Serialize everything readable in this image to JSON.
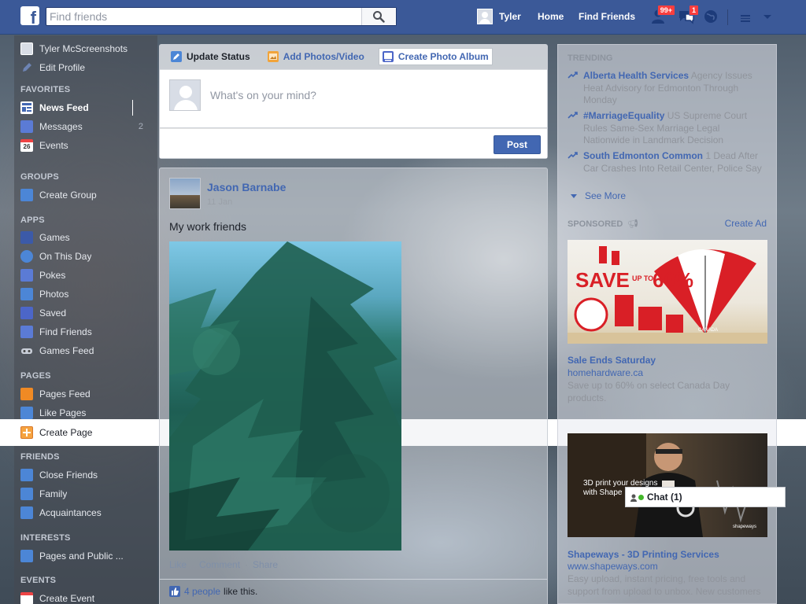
{
  "topbar": {
    "logo": "f",
    "search_placeholder": "Find friends",
    "profile_name": "Tyler",
    "links": [
      "Home",
      "Find Friends"
    ],
    "friend_requests_badge": "99+",
    "messages_badge": "1"
  },
  "sidebar": {
    "profile": {
      "name": "Tyler McScreenshots",
      "edit": "Edit Profile"
    },
    "sections": {
      "favorites": "FAVORITES",
      "groups": "GROUPS",
      "apps": "APPS",
      "pages": "PAGES",
      "friends": "FRIENDS",
      "interests": "INTERESTS",
      "events": "EVENTS"
    },
    "favorites": [
      {
        "label": "News Feed",
        "icon": "news-feed-icon"
      },
      {
        "label": "Messages",
        "icon": "messages-icon",
        "count": "2"
      },
      {
        "label": "Events",
        "icon": "calendar-icon",
        "date": "26"
      }
    ],
    "groups": [
      {
        "label": "Create Group",
        "icon": "create-group-icon"
      }
    ],
    "apps": [
      {
        "label": "Games",
        "icon": "games-icon"
      },
      {
        "label": "On This Day",
        "icon": "on-this-day-icon"
      },
      {
        "label": "Pokes",
        "icon": "pokes-icon"
      },
      {
        "label": "Photos",
        "icon": "photos-icon"
      },
      {
        "label": "Saved",
        "icon": "saved-icon"
      },
      {
        "label": "Find Friends",
        "icon": "find-friends-icon"
      },
      {
        "label": "Games Feed",
        "icon": "games-feed-icon"
      }
    ],
    "pages": [
      {
        "label": "Pages Feed",
        "icon": "pages-feed-icon"
      },
      {
        "label": "Like Pages",
        "icon": "like-pages-icon"
      },
      {
        "label": "Create Page",
        "icon": "create-page-icon"
      }
    ],
    "friends": [
      {
        "label": "Close Friends",
        "icon": "close-friends-icon"
      },
      {
        "label": "Family",
        "icon": "family-icon"
      },
      {
        "label": "Acquaintances",
        "icon": "acquaintances-icon"
      }
    ],
    "interests": [
      {
        "label": "Pages and Public ...",
        "icon": "pages-public-icon"
      }
    ],
    "events": [
      {
        "label": "Create Event",
        "icon": "create-event-icon"
      }
    ]
  },
  "composer": {
    "tabs": [
      "Update Status",
      "Add Photos/Video",
      "Create Photo Album"
    ],
    "placeholder": "What's on your mind?",
    "post_label": "Post"
  },
  "story": {
    "author": "Jason Barnabe",
    "time": "11 Jan",
    "text": "My work friends",
    "actions": [
      "Like",
      "Comment",
      "Share"
    ],
    "likes_link": "4 people",
    "likes_suffix": "like this."
  },
  "rightcol": {
    "trending_title": "TRENDING",
    "trending": [
      {
        "topic": "Alberta Health Services",
        "desc": "Agency Issues Heat Advisory for Edmonton Through Monday"
      },
      {
        "topic": "#MarriageEquality",
        "desc": "US Supreme Court Rules Same-Sex Marriage Legal Nationwide in Landmark Decision"
      },
      {
        "topic": "South Edmonton Common",
        "desc": "1 Dead After Car Crashes Into Retail Center, Police Say"
      }
    ],
    "see_more": "See More",
    "sponsored_title": "SPONSORED",
    "create_ad": "Create Ad",
    "ads": [
      {
        "image_text": {
          "save": "SAVE",
          "up_to": "UP TO",
          "pct": "60%",
          "canada": "CANADA"
        },
        "title": "Sale Ends Saturday",
        "url": "homehardware.ca",
        "desc": "Save up to 60% on select Canada Day products."
      },
      {
        "image_text": {
          "line1": "3D print your designs",
          "line2": "with Shape",
          "brand": "shapeways"
        },
        "title": "Shapeways - 3D Printing Services",
        "url": "www.shapeways.com",
        "desc": "Easy upload, instant pricing, free tools and support from upload to unbox. New customers"
      }
    ]
  },
  "chat": {
    "label": "Chat (1)"
  },
  "colors": {
    "brand": "#3b5998",
    "link": "#4267b2",
    "badge": "#fa3e3e",
    "online": "#42b72a"
  }
}
